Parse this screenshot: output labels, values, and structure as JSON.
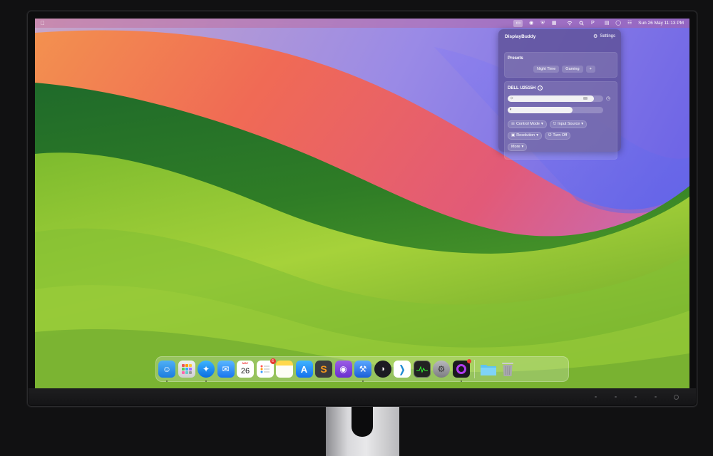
{
  "menubar": {
    "apple_icon": "apple-logo-icon",
    "icons": [
      "displaybuddy-icon",
      "record-icon",
      "shield-icon",
      "window-icon",
      "wifi-icon",
      "search-icon",
      "bluetooth-icon",
      "display-icon",
      "circle-icon",
      "control-center-icon"
    ],
    "datetime": "Sun 26 May  11:13 PM"
  },
  "popover": {
    "title": "DisplayBuddy",
    "settings_label": "Settings",
    "presets": {
      "title": "Presets",
      "items": [
        "Night Time",
        "Gaming"
      ],
      "add_label": "+"
    },
    "display": {
      "name": "DELL U2515H",
      "brightness": 0.9,
      "contrast": 0.68,
      "controls": {
        "control_mode": "Control Mode",
        "input_source": "Input Source",
        "resolution": "Resolution",
        "turn_off": "Turn Off",
        "more": "More"
      }
    }
  },
  "dock": {
    "calendar_month": "MAY",
    "calendar_day": "26",
    "reminders_badge": "6",
    "apps": [
      {
        "name": "finder",
        "icon": "finder-icon",
        "running": true
      },
      {
        "name": "launchpad",
        "icon": "launchpad-icon",
        "running": false
      },
      {
        "name": "safari",
        "icon": "safari-icon",
        "running": true
      },
      {
        "name": "mail",
        "icon": "mail-icon",
        "running": false
      },
      {
        "name": "calendar",
        "icon": "calendar-icon",
        "running": false
      },
      {
        "name": "reminders",
        "icon": "reminders-icon",
        "running": false
      },
      {
        "name": "notes",
        "icon": "notes-icon",
        "running": false
      },
      {
        "name": "app-store",
        "icon": "app-store-icon",
        "running": false
      },
      {
        "name": "sublime-text",
        "icon": "sublime-text-icon",
        "running": false
      },
      {
        "name": "github-desktop",
        "icon": "github-icon",
        "running": false
      },
      {
        "name": "xcode",
        "icon": "xcode-icon",
        "running": true
      },
      {
        "name": "linear",
        "icon": "linear-icon",
        "running": false
      },
      {
        "name": "vscode",
        "icon": "vscode-icon",
        "running": false
      },
      {
        "name": "activity-monitor",
        "icon": "activity-monitor-icon",
        "running": false
      },
      {
        "name": "system-settings",
        "icon": "system-settings-icon",
        "running": false
      },
      {
        "name": "screen-recorder",
        "icon": "screen-recorder-icon",
        "running": true
      },
      {
        "name": "downloads-folder",
        "icon": "folder-icon",
        "running": false
      },
      {
        "name": "trash",
        "icon": "trash-icon",
        "running": false
      }
    ]
  },
  "colors": {
    "popover_bg": "#5c5094",
    "wallpaper_green": "#3f8a27",
    "wallpaper_red": "#e8555c",
    "wallpaper_purple": "#8a78e8"
  }
}
